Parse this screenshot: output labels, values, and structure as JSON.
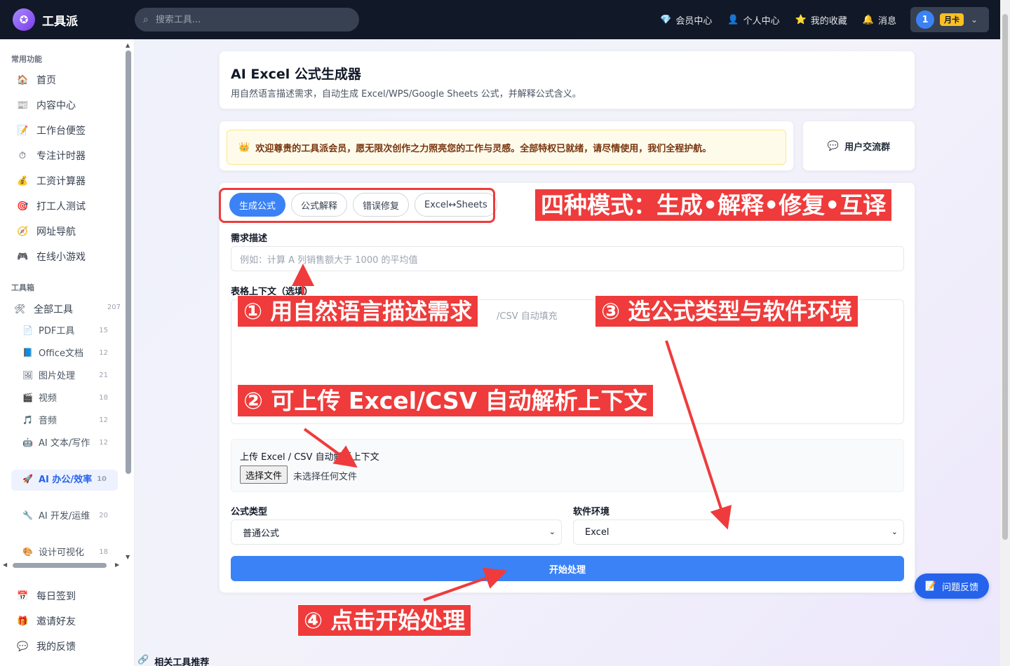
{
  "topbar": {
    "brand": "工具派",
    "search_placeholder": "搜索工具...",
    "links": [
      {
        "label": "会员中心",
        "icon": "diamond-icon",
        "glyph": "💎"
      },
      {
        "label": "个人中心",
        "icon": "user-icon",
        "glyph": "👤"
      },
      {
        "label": "我的收藏",
        "icon": "star-icon",
        "glyph": "⭐"
      },
      {
        "label": "消息",
        "icon": "bell-icon",
        "glyph": "🔔"
      }
    ],
    "user": {
      "avatar": "1",
      "badge": "月卡"
    }
  },
  "sidebar": {
    "section_common": "常用功能",
    "common": [
      {
        "label": "首页",
        "glyph": "🏠"
      },
      {
        "label": "内容中心",
        "glyph": "📰"
      },
      {
        "label": "工作台便签",
        "glyph": "📝"
      },
      {
        "label": "专注计时器",
        "glyph": "⏱"
      },
      {
        "label": "工资计算器",
        "glyph": "💰"
      },
      {
        "label": "打工人测试",
        "glyph": "🎯"
      },
      {
        "label": "网址导航",
        "glyph": "🧭"
      },
      {
        "label": "在线小游戏",
        "glyph": "🎮"
      }
    ],
    "section_tools": "工具箱",
    "all_tools": {
      "label": "全部工具",
      "count": "207",
      "glyph": "🛠"
    },
    "tools": [
      {
        "label": "PDF工具",
        "count": "15",
        "glyph": "📄"
      },
      {
        "label": "Office文档",
        "count": "12",
        "glyph": "📘"
      },
      {
        "label": "图片处理",
        "count": "21",
        "glyph": "🖼"
      },
      {
        "label": "视频",
        "count": "18",
        "glyph": "🎬"
      },
      {
        "label": "音频",
        "count": "12",
        "glyph": "🎵"
      },
      {
        "label": "AI 文本/写作",
        "count": "12",
        "glyph": "🤖"
      },
      {
        "label": "AI 办公/效率",
        "count": "10",
        "glyph": "🚀"
      },
      {
        "label": "AI 开发/运维",
        "count": "20",
        "glyph": "🔧"
      },
      {
        "label": "设计可视化",
        "count": "18",
        "glyph": "🎨"
      }
    ],
    "bottom": [
      {
        "label": "每日签到",
        "glyph": "📅"
      },
      {
        "label": "邀请好友",
        "glyph": "🎁"
      },
      {
        "label": "我的反馈",
        "glyph": "💬"
      }
    ]
  },
  "header_card": {
    "title": "AI Excel 公式生成器",
    "subtitle": "用自然语言描述需求，自动生成 Excel/WPS/Google Sheets 公式，并解释公式含义。"
  },
  "notice": {
    "text": "欢迎尊贵的工具派会员，愿无限次创作之力照亮您的工作与灵感。全部特权已就绪，请尽情使用，我们全程护航。",
    "glyph": "👑"
  },
  "group_button": {
    "label": "用户交流群",
    "glyph": "💬"
  },
  "tabs": [
    "生成公式",
    "公式解释",
    "错误修复",
    "Excel↔Sheets"
  ],
  "form": {
    "demand_label": "需求描述",
    "demand_placeholder": "例如：计算 A 列销售额大于 1000 的平均值",
    "context_label": "表格上下文（选填）",
    "context_placeholder_visible": "/CSV 自动填充",
    "upload_label": "上传 Excel / CSV 自动解析上下文",
    "file_button": "选择文件",
    "file_status": "未选择任何文件",
    "formula_type_label": "公式类型",
    "formula_type_value": "普通公式",
    "env_label": "软件环境",
    "env_value": "Excel",
    "submit": "开始处理"
  },
  "feedback": {
    "label": "问题反馈",
    "glyph": "📝"
  },
  "related": {
    "label": "相关工具推荐",
    "glyph": "🔗"
  },
  "annotations": {
    "modes": "四种模式：生成•解释•修复•互译",
    "step1": "① 用自然语言描述需求",
    "step2": "② 可上传 Excel/CSV 自动解析上下文",
    "step3": "③ 选公式类型与软件环境",
    "step4": "④ 点击开始处理",
    "color": "#ef3b3b"
  }
}
